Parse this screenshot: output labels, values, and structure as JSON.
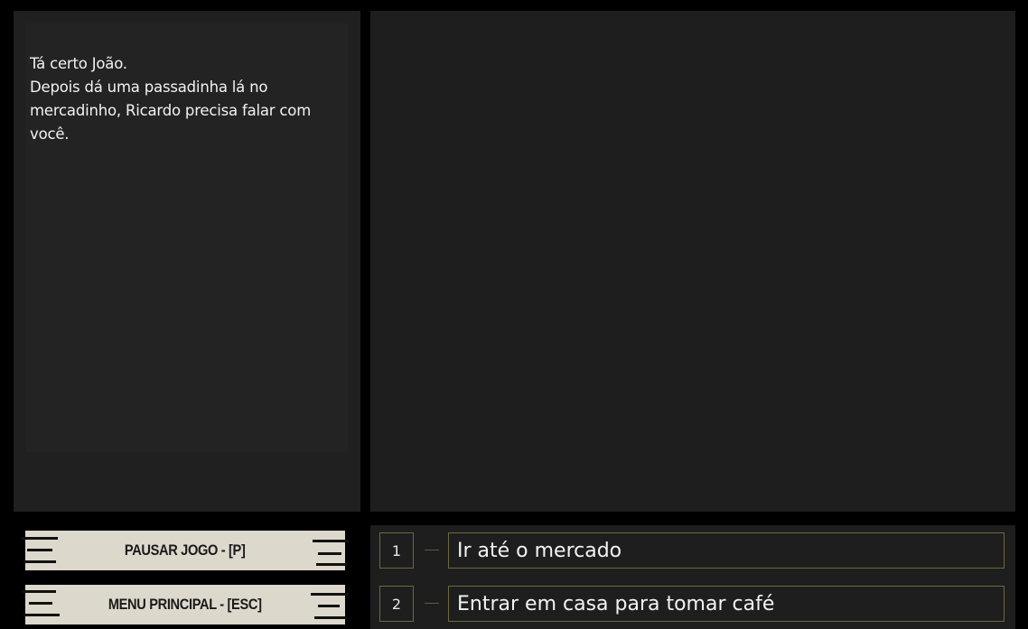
{
  "dialog": {
    "text": "Tá certo João.\nDepois dá uma passadinha lá no mercadinho, Ricardo precisa falar com você."
  },
  "buttons": {
    "pause_label": "PAUSAR JOGO - [P]",
    "menu_label": "MENU PRINCIPAL - [ESC]"
  },
  "choices": [
    {
      "number": "1",
      "label": "Ir até o mercado"
    },
    {
      "number": "2",
      "label": "Entrar em casa para tomar café"
    }
  ],
  "colors": {
    "background": "#000000",
    "panel": "#1f1f1f",
    "choice_border": "#6b6a3a",
    "button_paper": "#ddd8cc",
    "text": "#f2f2f2"
  }
}
